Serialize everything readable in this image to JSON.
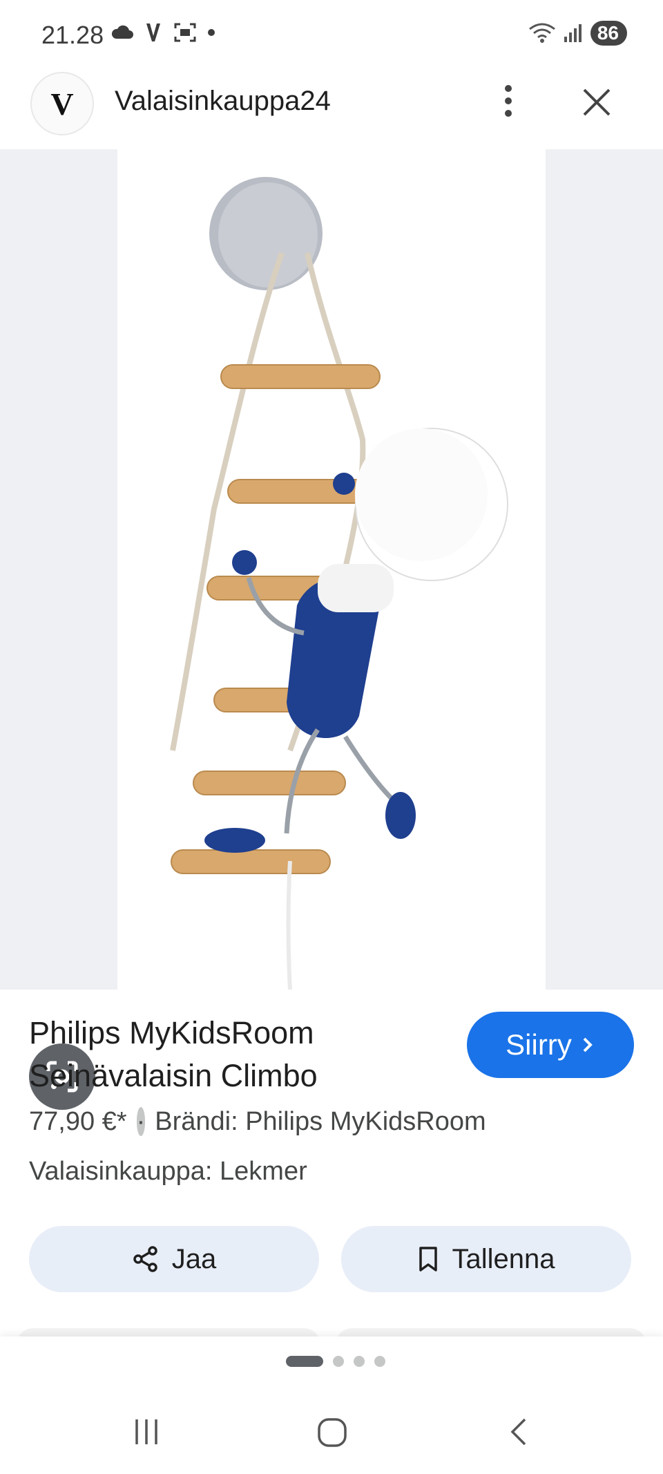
{
  "status_bar": {
    "time": "21.28",
    "battery": "86",
    "left_icons": [
      "cloud-icon",
      "v-app-icon",
      "screenshot-icon",
      "dot-icon"
    ],
    "right_icons": [
      "wifi-icon",
      "signal-icon",
      "battery-icon"
    ]
  },
  "header": {
    "site_initial": "V",
    "site_name": "Valaisinkauppa24"
  },
  "product": {
    "title_line1": "Philips MyKidsRoom",
    "title_line2": "Seinävalaisin Climbo",
    "price": "77,90 €*",
    "separator": "·",
    "brand": "Brändi: Philips MyKidsRoom",
    "store": "Valaisinkauppa: Lekmer"
  },
  "buttons": {
    "go_label": "Siirry",
    "share_label": "Jaa",
    "save_label": "Tallenna"
  },
  "carousel": {
    "page_count": 4,
    "active_index": 0
  },
  "colors": {
    "accent": "#1a73e8",
    "chip_bg": "#e8eef8",
    "lamp_blue": "#1f3f8f",
    "wood": "#d9a86c"
  }
}
